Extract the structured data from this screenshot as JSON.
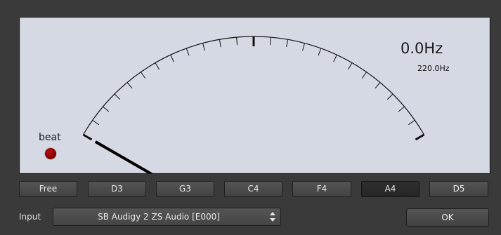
{
  "tuner": {
    "frequency": "0.0Hz",
    "reference": "220.0Hz",
    "beat_label": "beat",
    "beat_led_color": "#8c0000"
  },
  "notes": [
    {
      "label": "Free",
      "selected": false
    },
    {
      "label": "D3",
      "selected": false
    },
    {
      "label": "G3",
      "selected": false
    },
    {
      "label": "C4",
      "selected": false
    },
    {
      "label": "F4",
      "selected": false
    },
    {
      "label": "A4",
      "selected": true
    },
    {
      "label": "D5",
      "selected": false
    }
  ],
  "input": {
    "label": "Input",
    "selected": "SB Audigy 2 ZS Audio [E000]"
  },
  "ok_label": "OK",
  "colors": {
    "dial_background": "#d4d9e3",
    "window_background": "#3a3a3a",
    "button_background": "#4a4a4a",
    "needle": "#000000"
  }
}
